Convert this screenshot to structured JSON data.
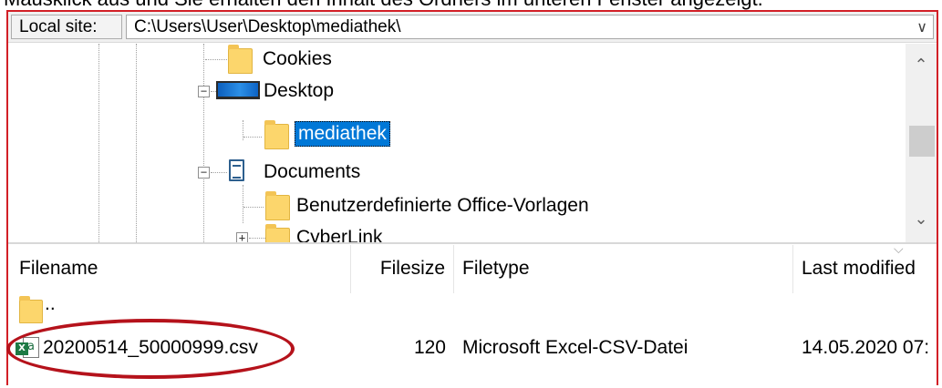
{
  "caption": "Mausklick aus und Sie erhalten den Inhalt des Ordners im unteren Fenster angezeigt.",
  "local_site": {
    "label": "Local site:",
    "path": "C:\\Users\\User\\Desktop\\mediathek\\",
    "dropdown_icon": "chevron-down-icon"
  },
  "tree": {
    "items": [
      {
        "label": "Cookies",
        "icon": "folder-icon",
        "expander": ""
      },
      {
        "label": "Desktop",
        "icon": "desktop-icon",
        "expander": "−"
      },
      {
        "label": "mediathek",
        "icon": "folder-icon",
        "expander": "",
        "selected": true
      },
      {
        "label": "Documents",
        "icon": "document-icon",
        "expander": "−"
      },
      {
        "label": "Benutzerdefinierte Office-Vorlagen",
        "icon": "folder-icon",
        "expander": ""
      },
      {
        "label": "CyberLink",
        "icon": "folder-icon",
        "expander": "+"
      }
    ],
    "scroll_up": "⌃",
    "scroll_down": "⌄"
  },
  "file_list": {
    "columns": [
      "Filename",
      "Filesize",
      "Filetype",
      "Last modified"
    ],
    "rows": [
      {
        "name": "..",
        "size": "",
        "type": "",
        "modified": "",
        "icon": "folder-icon"
      },
      {
        "name": "20200514_50000999.csv",
        "size": "120",
        "type": "Microsoft Excel-CSV-Datei",
        "modified": "14.05.2020 07:",
        "icon": "excel-csv-icon",
        "icon_badge": "a",
        "icon_x": "X"
      }
    ]
  },
  "colors": {
    "frame": "#d21f26",
    "selection": "#0078d7",
    "highlight_ellipse": "#b5121b",
    "folder": "#fcd66c"
  }
}
